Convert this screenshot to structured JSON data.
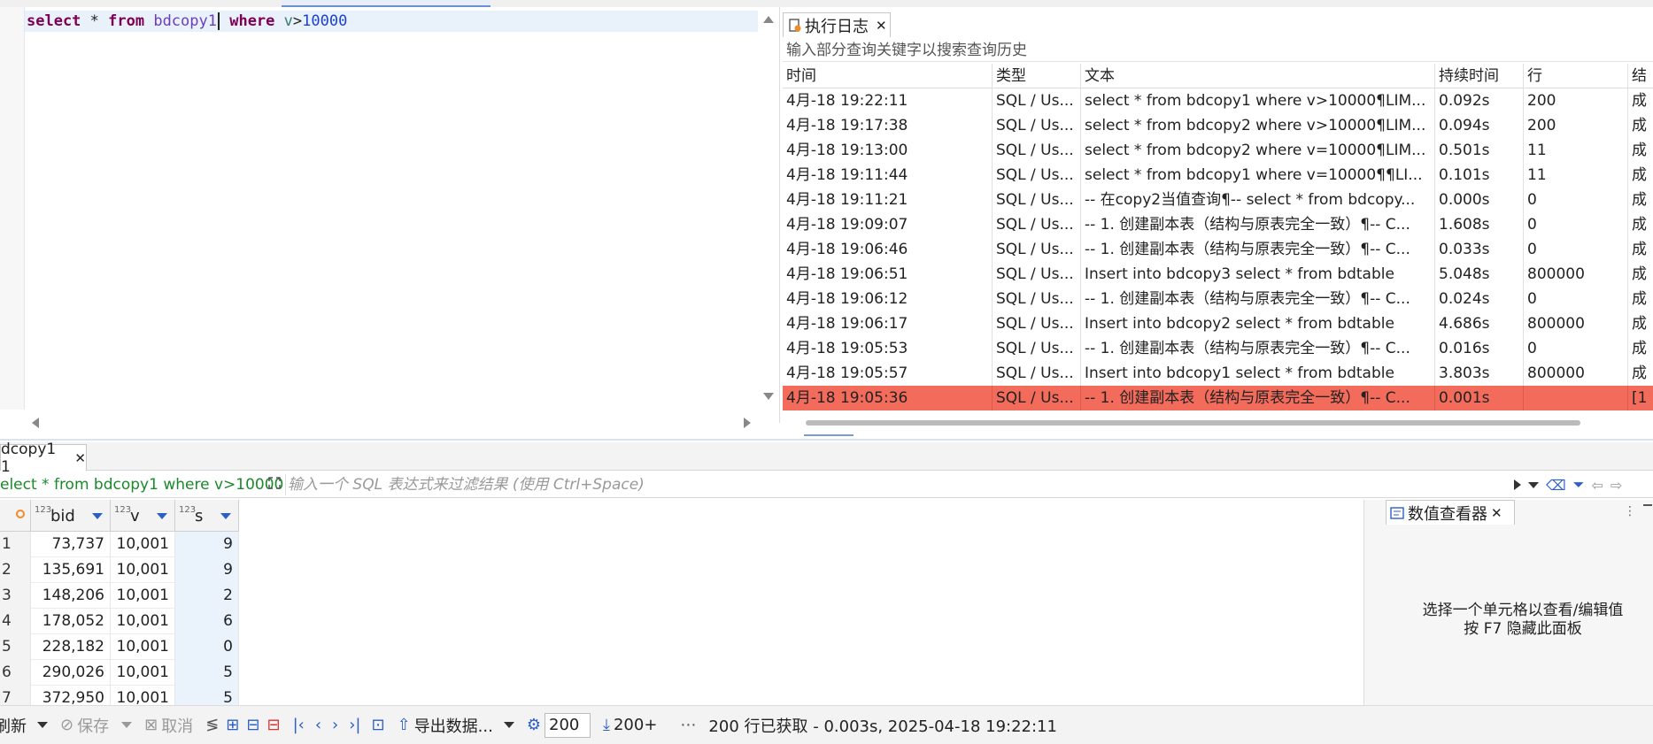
{
  "editor": {
    "sql": {
      "kw_select": "select",
      "star": " * ",
      "kw_from": "from",
      "table": " bdcopy1",
      "kw_where": " where",
      "column": " v",
      "op": ">",
      "value": "10000"
    }
  },
  "log": {
    "tab_label": "执行日志",
    "search_placeholder": "输入部分查询关键字以搜索查询历史",
    "columns": [
      "时间",
      "类型",
      "文本",
      "持续时间",
      "行",
      "结"
    ],
    "rows": [
      [
        "4月-18 19:22:11",
        "SQL / Us...",
        "select * from bdcopy1 where v>10000¶LIM...",
        "0.092s",
        "200",
        "成"
      ],
      [
        "4月-18 19:17:38",
        "SQL / Us...",
        "select * from bdcopy2 where v>10000¶LIM...",
        "0.094s",
        "200",
        "成"
      ],
      [
        "4月-18 19:13:00",
        "SQL / Us...",
        "select * from bdcopy2 where v=10000¶LIM...",
        "0.501s",
        "11",
        "成"
      ],
      [
        "4月-18 19:11:44",
        "SQL / Us...",
        "select * from bdcopy1 where v=10000¶¶LI...",
        "0.101s",
        "11",
        "成"
      ],
      [
        "4月-18 19:11:21",
        "SQL / Us...",
        "-- 在copy2当值查询¶-- select * from bdcopy...",
        "0.000s",
        "0",
        "成"
      ],
      [
        "4月-18 19:09:07",
        "SQL / Us...",
        "-- 1. 创建副本表（结构与原表完全一致）¶-- C...",
        "1.608s",
        "0",
        "成"
      ],
      [
        "4月-18 19:06:46",
        "SQL / Us...",
        "-- 1. 创建副本表（结构与原表完全一致）¶-- C...",
        "0.033s",
        "0",
        "成"
      ],
      [
        "4月-18 19:06:51",
        "SQL / Us...",
        "Insert into bdcopy3 select * from bdtable",
        "5.048s",
        "800000",
        "成"
      ],
      [
        "4月-18 19:06:12",
        "SQL / Us...",
        "-- 1. 创建副本表（结构与原表完全一致）¶-- C...",
        "0.024s",
        "0",
        "成"
      ],
      [
        "4月-18 19:06:17",
        "SQL / Us...",
        "Insert into bdcopy2 select * from bdtable",
        "4.686s",
        "800000",
        "成"
      ],
      [
        "4月-18 19:05:53",
        "SQL / Us...",
        "-- 1. 创建副本表（结构与原表完全一致）¶-- C...",
        "0.016s",
        "0",
        "成"
      ],
      [
        "4月-18 19:05:57",
        "SQL / Us...",
        "Insert into bdcopy1 select * from bdtable",
        "3.803s",
        "800000",
        "成"
      ],
      [
        "4月-18 19:05:36",
        "SQL / Us...",
        "-- 1. 创建副本表（结构与原表完全一致）¶-- C...",
        "0.001s",
        "",
        "[1"
      ]
    ],
    "error_row_index": 12
  },
  "results": {
    "tab_label": "dcopy1 1",
    "filter_sql": "elect * from bdcopy1 where v>10000",
    "filter_placeholder": "输入一个 SQL 表达式来过滤结果 (使用 Ctrl+Space)",
    "columns": [
      {
        "type": "123",
        "name": "bid"
      },
      {
        "type": "123",
        "name": "v"
      },
      {
        "type": "123",
        "name": "s"
      }
    ],
    "rows": [
      [
        "1",
        "73,737",
        "10,001",
        "9"
      ],
      [
        "2",
        "135,691",
        "10,001",
        "9"
      ],
      [
        "3",
        "148,206",
        "10,001",
        "2"
      ],
      [
        "4",
        "178,052",
        "10,001",
        "6"
      ],
      [
        "5",
        "228,182",
        "10,001",
        "0"
      ],
      [
        "6",
        "290,026",
        "10,001",
        "5"
      ],
      [
        "7",
        "372,950",
        "10,001",
        "5"
      ]
    ]
  },
  "value_viewer": {
    "tab_label": "数值查看器",
    "message_line1": "选择一个单元格以查看/编辑值",
    "message_line2": "按 F7 隐藏此面板"
  },
  "toolbar": {
    "refresh_label": "刷新",
    "save_label": "保存",
    "cancel_label": "取消",
    "export_label": "导出数据...",
    "fetch_size": "200",
    "fetch_more_label": "200+",
    "status": "200 行已获取 - 0.003s, 2025-04-18 19:22:11"
  },
  "colors": {
    "error_row": "#f26b5b",
    "keyword": "#7f0055",
    "accent": "#2c5fc5"
  }
}
